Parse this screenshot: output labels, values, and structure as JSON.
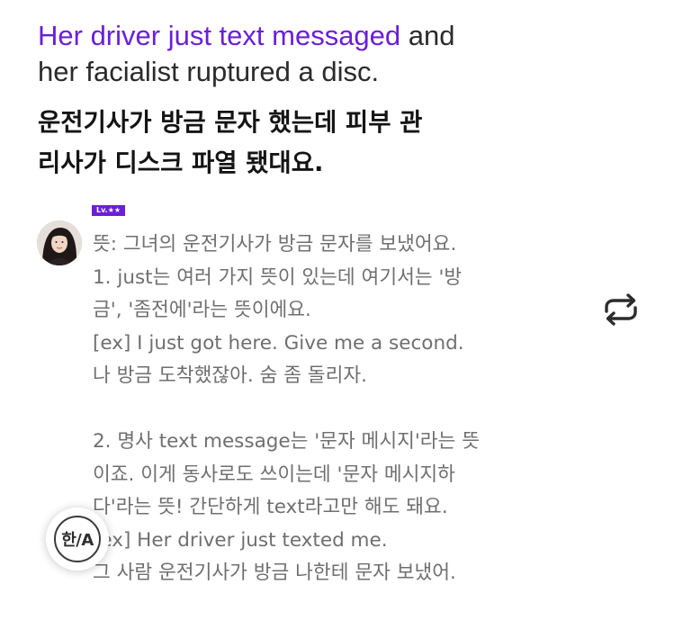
{
  "post": {
    "sentence_en_highlight": "Her driver just text messaged",
    "sentence_en_rest_1": " and",
    "sentence_en_line2": "her facialist ruptured a disc.",
    "sentence_ko_line1": "운전기사가 방금 문자 했는데 피부 관",
    "sentence_ko_line2": "리사가 디스크 파열 됐대요."
  },
  "comment": {
    "level_badge": "Lv.★★",
    "lines": [
      "뜻: 그녀의 운전기사가 방금 문자를 보냈어요.",
      "1. just는 여러 가지 뜻이 있는데 여기서는 '방",
      "금', '좀전에'라는 뜻이에요.",
      "[ex] I just got here. Give me a second.",
      "나 방금 도착했잖아. 숨 좀 돌리자.",
      "",
      "2. 명사 text message는 '문자 메시지'라는 뜻",
      "이죠. 이게 동사로도 쓰이는데 '문자 메시지하",
      "다'라는 뜻! 간단하게 text라고만 해도 돼요.",
      "[ex] Her driver just texted me.",
      "그 사람 운전기사가 방금 나한테 문자 보냈어."
    ]
  },
  "controls": {
    "translate_label": "한/A",
    "repost_icon": "repost-icon"
  },
  "colors": {
    "accent": "#6a1fd8",
    "comment_text": "#6f6f6f",
    "heading_text": "#141414"
  }
}
